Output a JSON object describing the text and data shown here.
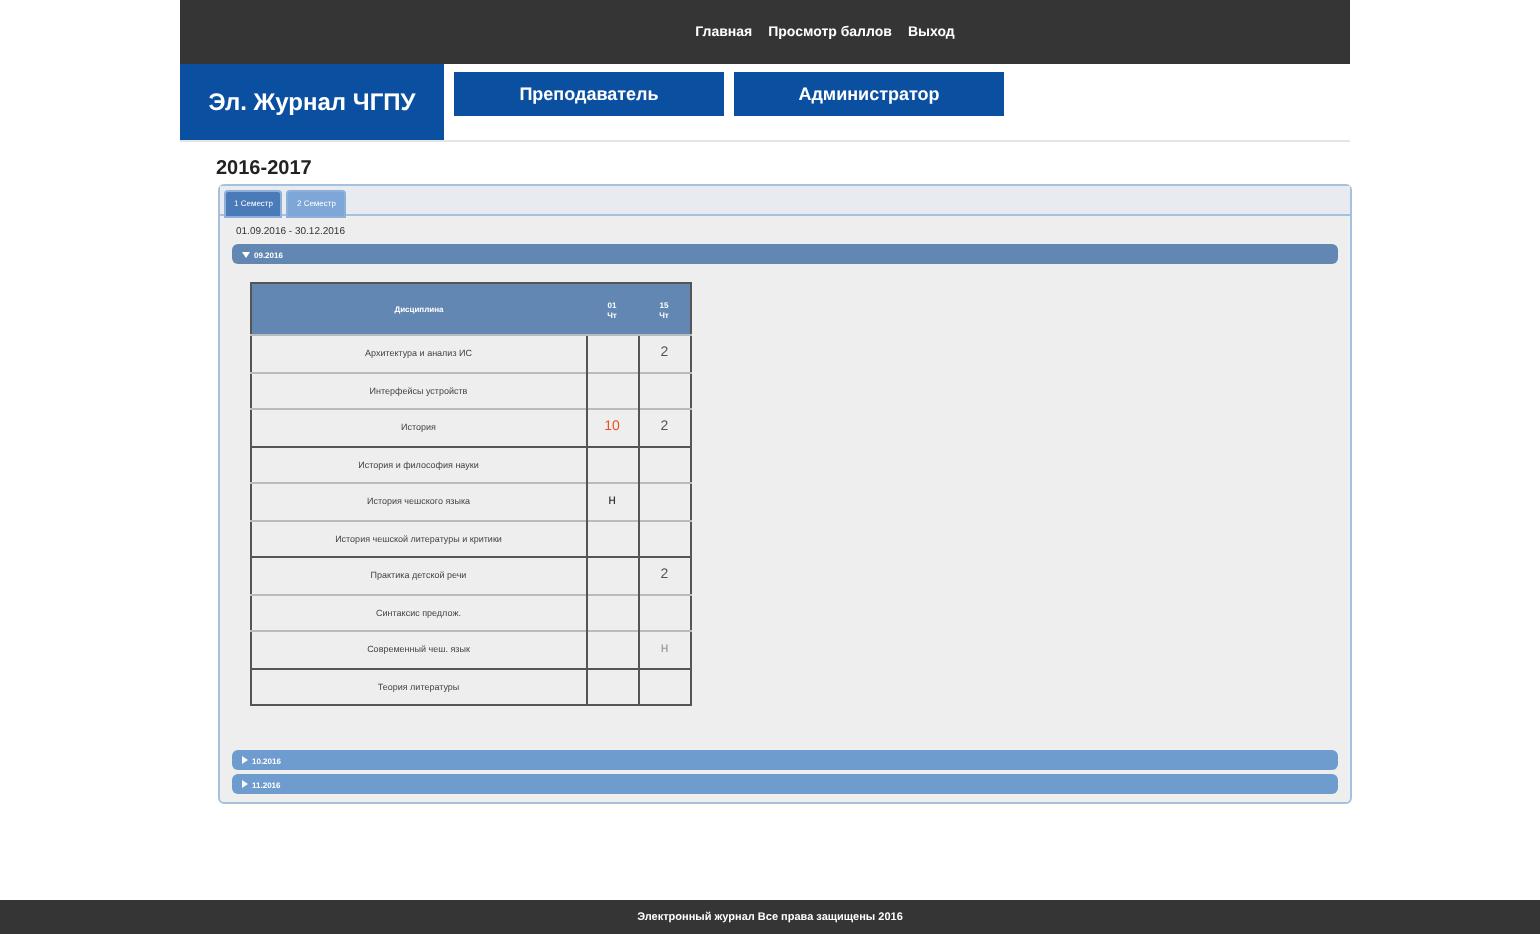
{
  "top_menu": [
    {
      "label": "Главная"
    },
    {
      "label": "Просмотр баллов"
    },
    {
      "label": "Выход"
    }
  ],
  "logo": "Эл. Журнал ЧГПУ",
  "nav": [
    {
      "label": "Преподаватель"
    },
    {
      "label": "Администратор"
    }
  ],
  "year": "2016-2017",
  "tabs": [
    {
      "label": "1 Семестр",
      "selected": true
    },
    {
      "label": "2 Семестр",
      "selected": false
    }
  ],
  "period": "01.09.2016 - 30.12.2016",
  "months": [
    {
      "label": "09.2016",
      "expanded": true,
      "table": {
        "columns": [
          "Дисциплина",
          {
            "day": "01",
            "weekday": "Чт"
          },
          {
            "day": "15",
            "weekday": "Чт"
          }
        ],
        "rows": [
          {
            "discipline": "Архитектура и анализ ИС",
            "second_column": {
              "text": "2",
              "color": "#555555"
            }
          },
          {
            "discipline": "Интерфейсы устройств"
          },
          {
            "discipline": "История",
            "first_column": {
              "text": "10",
              "color": "#e8541e"
            },
            "second_column": {
              "text": "2",
              "color": "#555555"
            }
          },
          {
            "discipline": "История и философия науки"
          },
          {
            "discipline": "История чешского языка",
            "first_column": {
              "text": "н",
              "color": "#333333"
            }
          },
          {
            "discipline": "История чешской литературы и критики"
          },
          {
            "discipline": "Практика детской речи",
            "second_column": {
              "text": "2",
              "color": "#555555"
            }
          },
          {
            "discipline": "Синтаксис предлож."
          },
          {
            "discipline": "Современный чеш. язык",
            "second_column": {
              "text": "н",
              "color": "#999999"
            }
          },
          {
            "discipline": "Теория литературы"
          }
        ]
      }
    },
    {
      "label": "10.2016",
      "expanded": false
    },
    {
      "label": "11.2016",
      "expanded": false
    }
  ],
  "footer": "Электронный журнал Все права защищены 2016"
}
